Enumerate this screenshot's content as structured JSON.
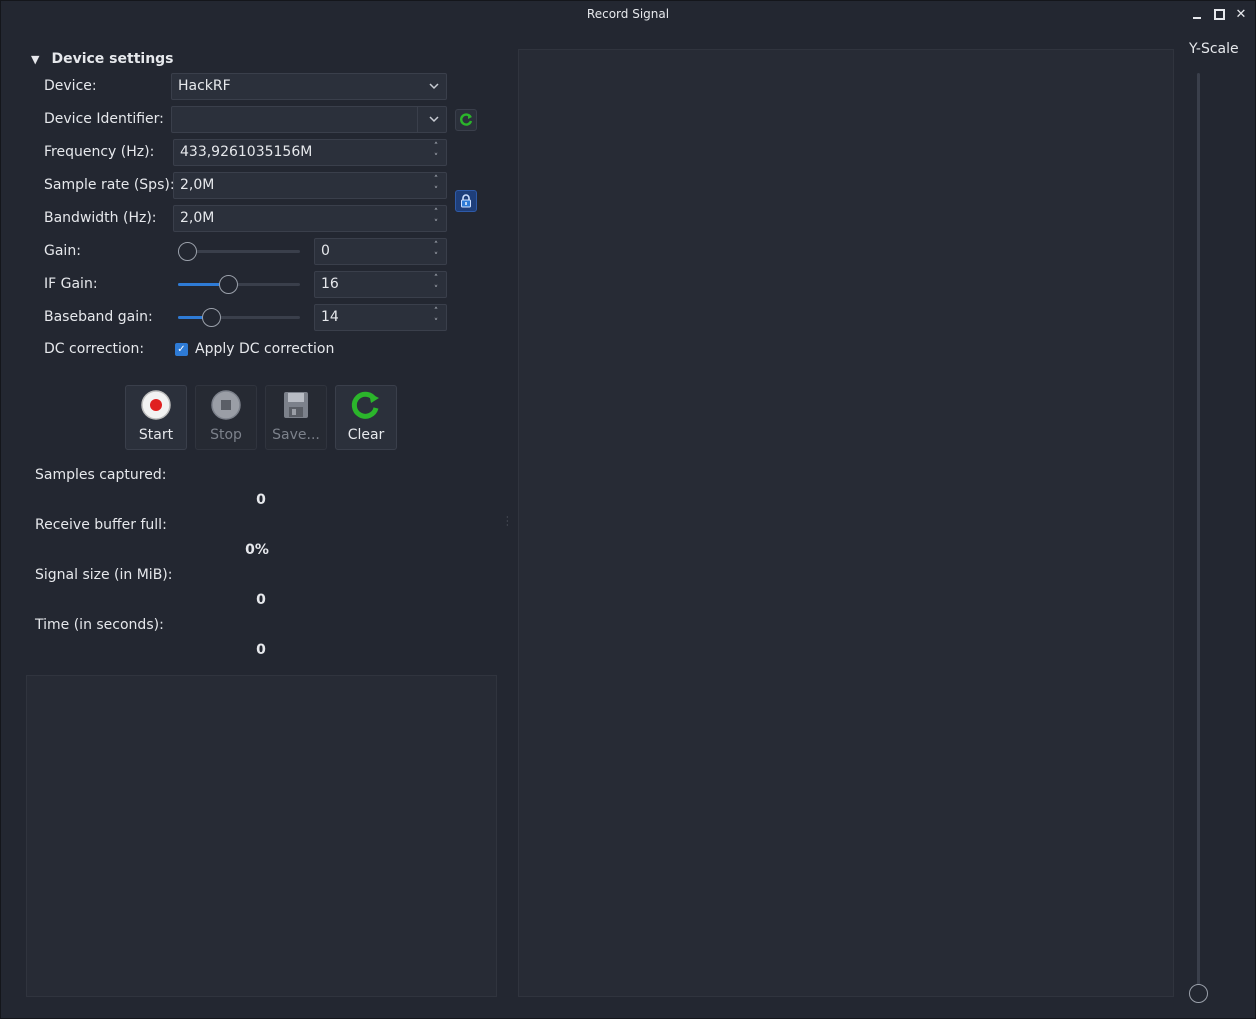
{
  "window": {
    "title": "Record Signal"
  },
  "section": {
    "title": "Device settings"
  },
  "fields": {
    "device_label": "Device:",
    "device_value": "HackRF",
    "device_id_label": "Device Identifier:",
    "device_id_value": "",
    "frequency_label": "Frequency (Hz):",
    "frequency_value": "433,9261035156M",
    "sample_rate_label": "Sample rate (Sps):",
    "sample_rate_value": "2,0M",
    "bandwidth_label": "Bandwidth (Hz):",
    "bandwidth_value": "2,0M",
    "gain_label": "Gain:",
    "gain_value": "0",
    "if_gain_label": "IF Gain:",
    "if_gain_value": "16",
    "baseband_gain_label": "Baseband gain:",
    "baseband_gain_value": "14",
    "dc_label": "DC correction:",
    "dc_checkbox_label": "Apply DC correction"
  },
  "sliders": {
    "gain_fraction": 0.0,
    "if_gain_fraction": 0.4,
    "baseband_gain_fraction": 0.23
  },
  "buttons": {
    "start": "Start",
    "stop": "Stop",
    "save": "Save...",
    "clear": "Clear"
  },
  "stats": {
    "samples_label": "Samples captured:",
    "samples_value": "0",
    "buffer_label": "Receive buffer full:",
    "buffer_value": "0%",
    "size_label": "Signal size (in MiB):",
    "size_value": "0",
    "time_label": "Time (in seconds):",
    "time_value": "0"
  },
  "yscale": {
    "label": "Y-Scale"
  },
  "colors": {
    "accent": "#2e7bd6",
    "background": "#232731",
    "record": "#e02020",
    "refresh": "#2bb52b"
  },
  "icons": [
    "refresh-icon",
    "lock-icon",
    "record-icon",
    "stop-icon",
    "save-icon",
    "clear-icon"
  ]
}
